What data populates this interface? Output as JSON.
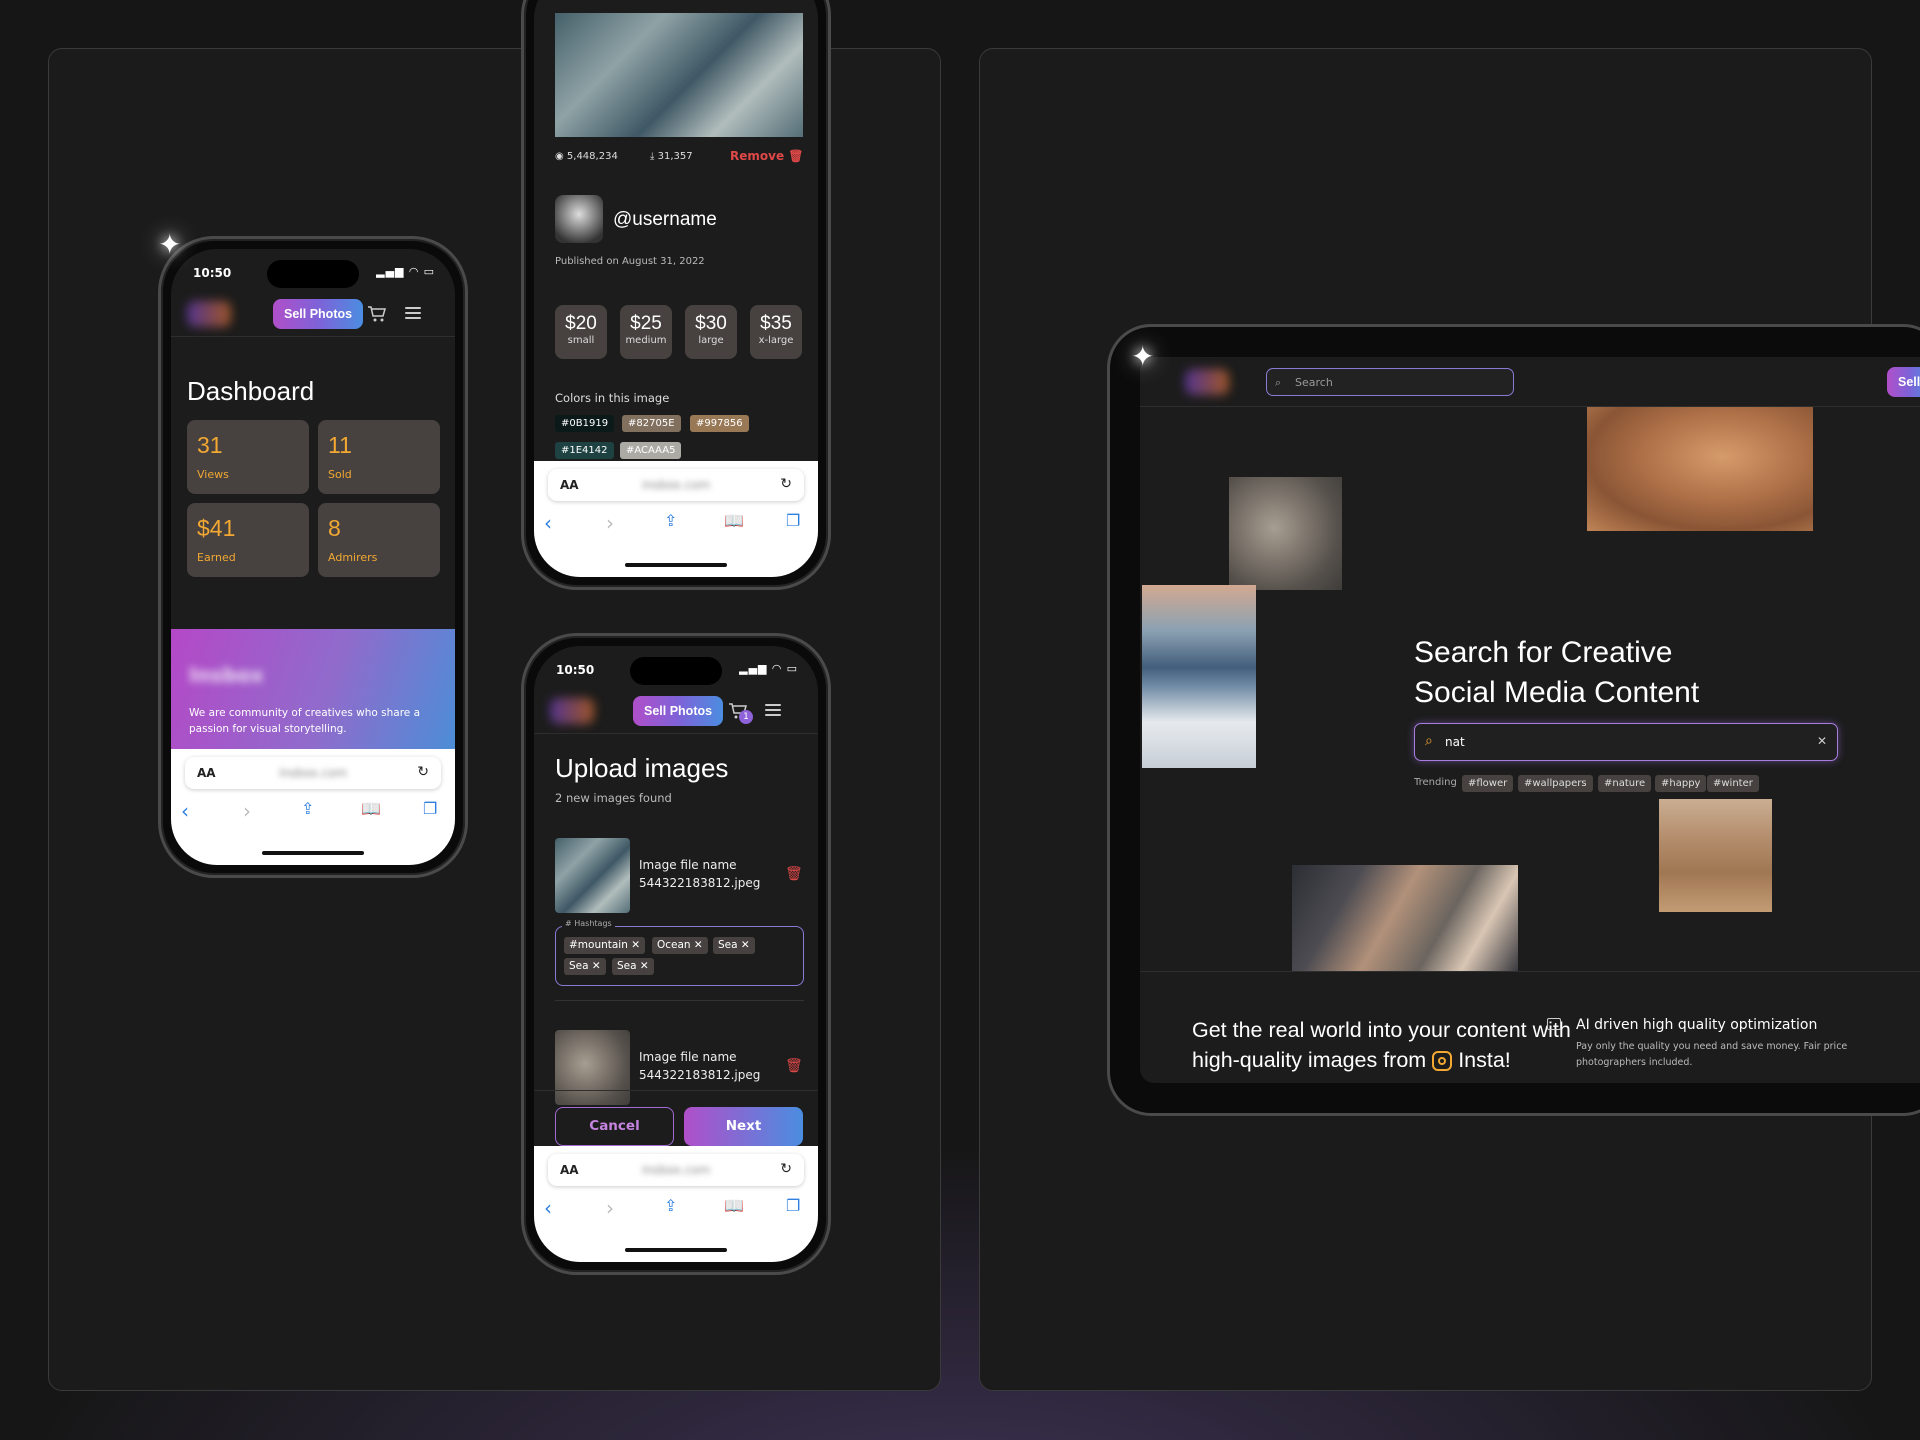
{
  "status_time": "10:50",
  "nav": {
    "sell_label": "Sell Photos"
  },
  "browser": {
    "aa": "AA",
    "url": "insbox.com"
  },
  "dashboard": {
    "title": "Dashboard",
    "stats": [
      {
        "value": "31",
        "label": "Views"
      },
      {
        "value": "11",
        "label": "Sold"
      },
      {
        "value": "$41",
        "label": "Earned"
      },
      {
        "value": "8",
        "label": "Admirers"
      }
    ],
    "promo_brand": "Insbox",
    "promo_text": "We are community of creatives who share a passion for visual storytelling."
  },
  "details": {
    "views": "5,448,234",
    "downloads": "31,357",
    "remove_label": "Remove",
    "username": "@username",
    "published": "Published on August 31, 2022",
    "prices": [
      {
        "price": "$20",
        "size": "small"
      },
      {
        "price": "$25",
        "size": "medium"
      },
      {
        "price": "$30",
        "size": "large"
      },
      {
        "price": "$35",
        "size": "x-large"
      }
    ],
    "colors_title": "Colors in this image",
    "colors": [
      {
        "hex": "#0B1919",
        "bg": "#0B1919"
      },
      {
        "hex": "#82705E",
        "bg": "#82705E"
      },
      {
        "hex": "#997856",
        "bg": "#997856"
      },
      {
        "hex": "#1E4142",
        "bg": "#1E4142"
      },
      {
        "hex": "#ACAAA5",
        "bg": "#ACAAA5"
      }
    ]
  },
  "upload": {
    "cart_count": "1",
    "title": "Upload images",
    "subtitle": "2 new images found",
    "files": [
      {
        "label": "Image file name",
        "name": "544322183812.jpeg"
      },
      {
        "label": "Image file name",
        "name": "544322183812.jpeg"
      }
    ],
    "hashtags_legend": "# Hashtags",
    "tags": [
      "#mountain",
      "Ocean",
      "Sea",
      "Sea",
      "Sea"
    ],
    "cancel_label": "Cancel",
    "next_label": "Next"
  },
  "tablet": {
    "search_placeholder": "Search",
    "sell_label": "Sell",
    "hero_line1": "Search for Creative",
    "hero_line2": "Social Media Content",
    "query": "nat",
    "trending_label": "Trending",
    "trending": [
      "#flower",
      "#wallpapers",
      "#nature",
      "#happy",
      "#winter"
    ],
    "bottom_line1": "Get the real world into your content with",
    "bottom_line2_a": "high-quality images from",
    "bottom_line2_b": "Insta!",
    "feature_title": "AI driven high quality optimization",
    "feature_desc": "Pay only the quality you need and save money. Fair price photographers included."
  }
}
